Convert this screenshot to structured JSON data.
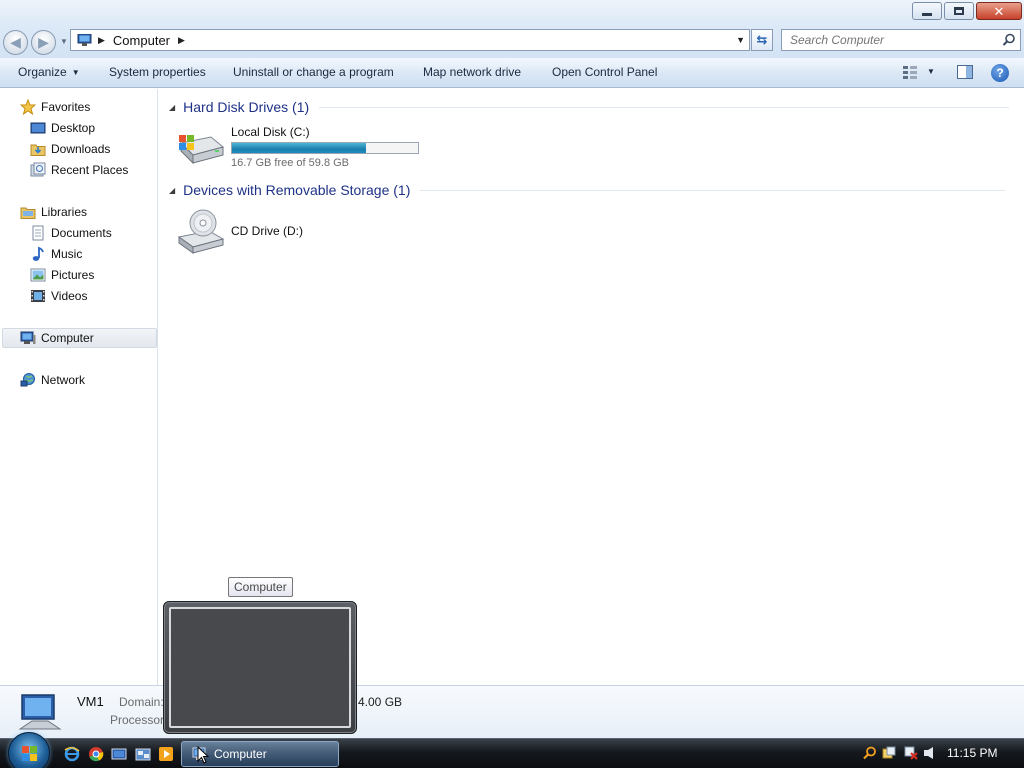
{
  "window": {
    "minimize": "minimize",
    "maximize": "restore",
    "close": "close"
  },
  "address": {
    "crumb": "Computer",
    "search_placeholder": "Search Computer"
  },
  "commands": {
    "organize": "Organize",
    "system_properties": "System properties",
    "uninstall": "Uninstall or change a program",
    "map_drive": "Map network drive",
    "control_panel": "Open Control Panel",
    "help": "?"
  },
  "nav": {
    "favorites": "Favorites",
    "desktop": "Desktop",
    "downloads": "Downloads",
    "recent_places": "Recent Places",
    "libraries": "Libraries",
    "documents": "Documents",
    "music": "Music",
    "pictures": "Pictures",
    "videos": "Videos",
    "computer": "Computer",
    "network": "Network"
  },
  "content": {
    "group_hdd": "Hard Disk Drives (1)",
    "group_removable": "Devices with Removable Storage (1)",
    "drive_c": {
      "name": "Local Disk (C:)",
      "free_text": "16.7 GB free of 59.8 GB",
      "used_fraction": 0.72
    },
    "drive_d": {
      "name": "CD Drive (D:)"
    }
  },
  "details": {
    "name": "VM1",
    "domain_label": "Domain:",
    "processor_label": "Processor:",
    "memory_value": "4.00 GB"
  },
  "taskbar": {
    "window_button": "Computer",
    "tooltip": "Computer",
    "clock": "11:15 PM"
  },
  "colors": {
    "accent": "#1e3287",
    "drive_fill": "#1d7fab"
  }
}
